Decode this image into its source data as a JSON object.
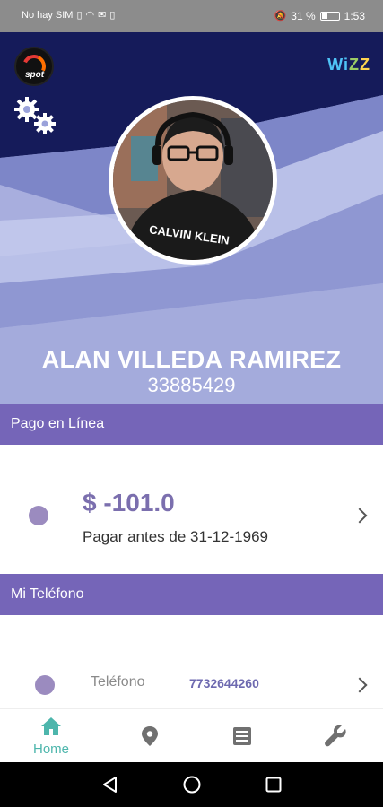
{
  "status_bar": {
    "carrier": "No hay SIM",
    "battery": "31 %",
    "time": "1:53"
  },
  "brand": {
    "left_logo_text": "spot",
    "right_logo_text": "WiZZ"
  },
  "profile": {
    "name": "ALAN VILLEDA RAMIREZ",
    "account_number": "33885429"
  },
  "payment_section": {
    "title": "Pago en Línea",
    "amount": "$ -101.0",
    "due_text": "Pagar antes de 31-12-1969"
  },
  "phone_section": {
    "title": "Mi Teléfono",
    "label": "Teléfono",
    "value": "7732644260"
  },
  "bottom_nav": {
    "home_label": "Home",
    "items": [
      "home-icon",
      "location-pin-icon",
      "list-icon",
      "wrench-icon"
    ]
  },
  "colors": {
    "accent": "#7565b8",
    "nav_active": "#4db6ac",
    "header_dark": "#1a2060"
  }
}
